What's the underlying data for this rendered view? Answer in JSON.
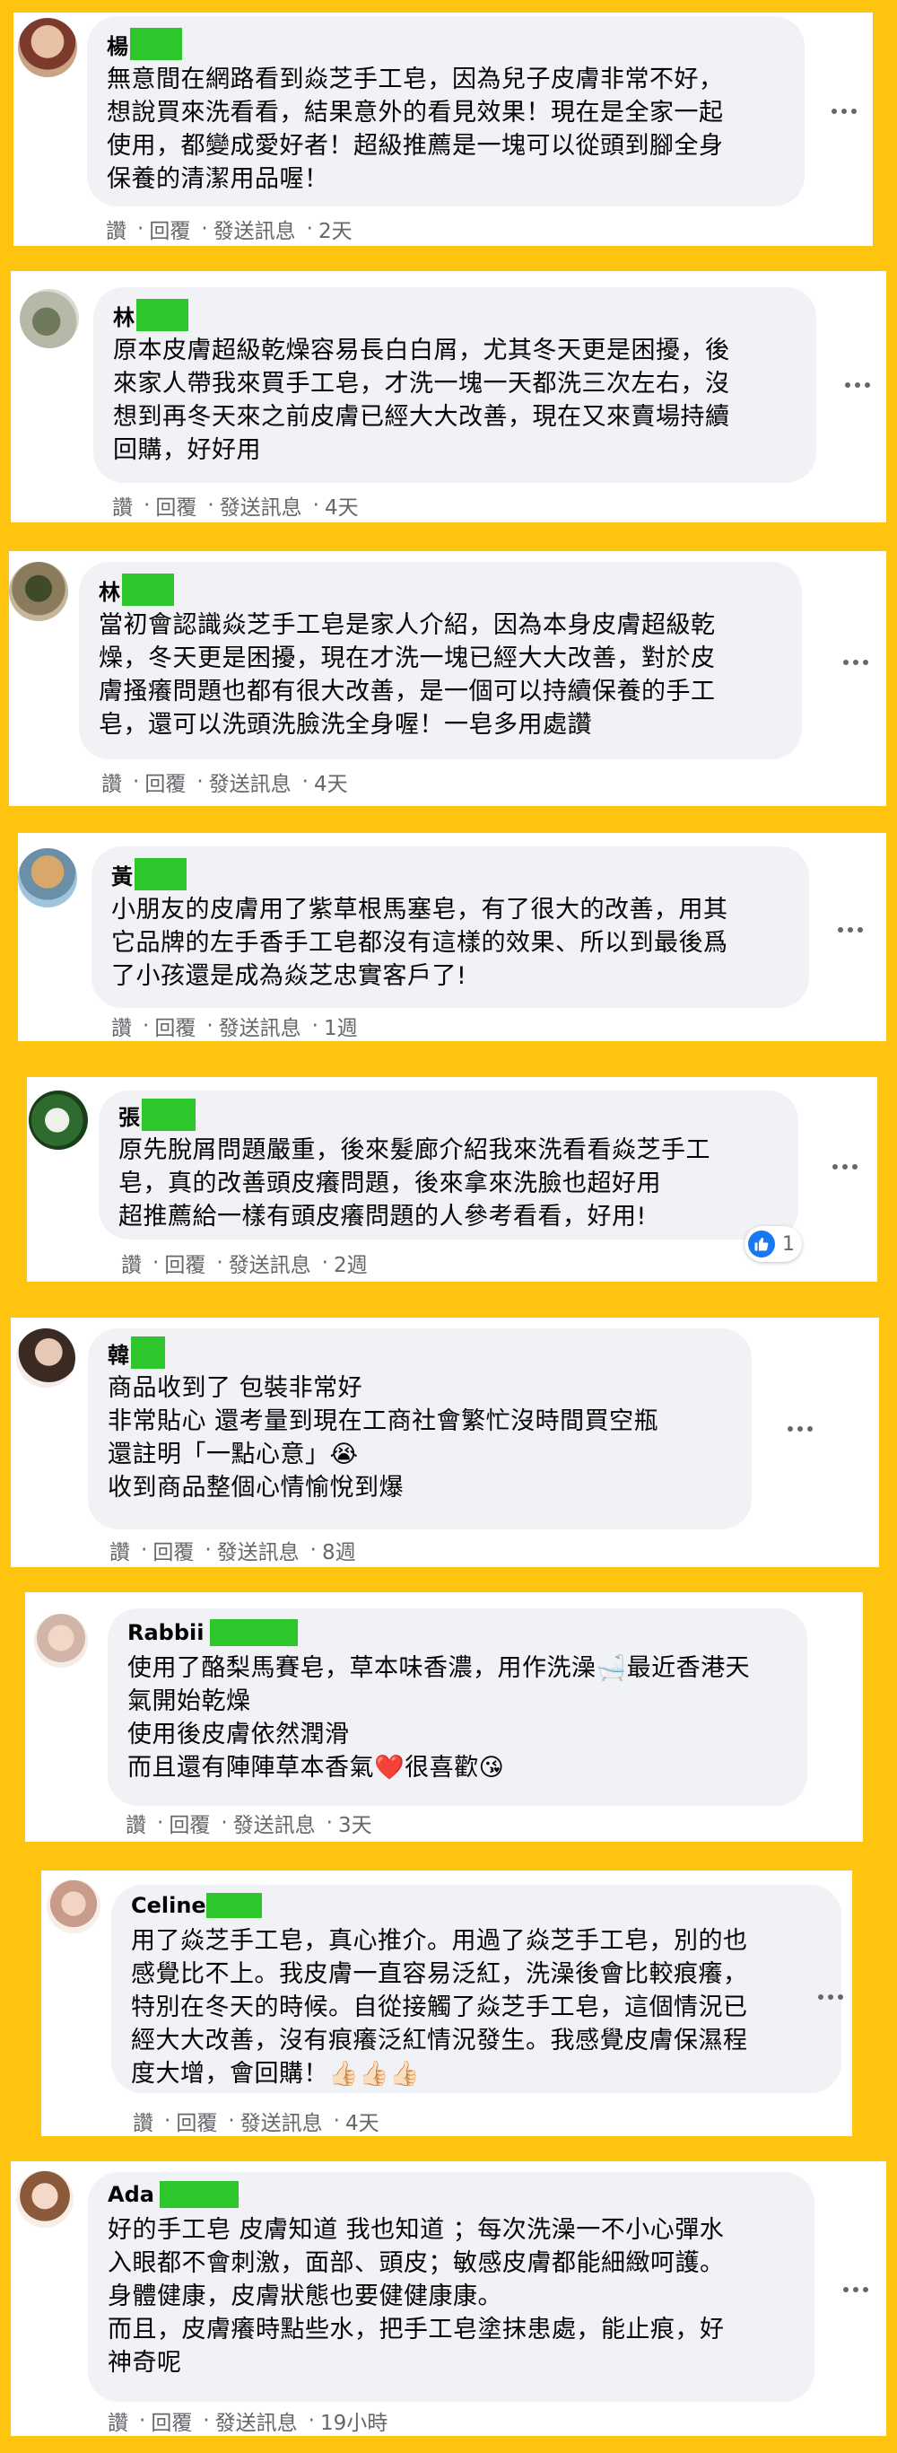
{
  "actions": {
    "like": "讚",
    "reply": "回覆",
    "message": "發送訊息",
    "sep": "·"
  },
  "comments": [
    {
      "name": "楊",
      "text": "無意間在網路看到焱芝手工皂，因為兒子皮膚非常不好，\n想說買來洗看看，結果意外的看見效果！現在是全家一起\n使用，都變成愛好者！超級推薦是一塊可以從頭到腳全身\n保養的清潔用品喔！",
      "time": "2天"
    },
    {
      "name": "林",
      "text": "原本皮膚超級乾燥容易長白白屑，尤其冬天更是困擾，後\n來家人帶我來買手工皂，才洗一塊一天都洗三次左右，沒\n想到再冬天來之前皮膚已經大大改善，現在又來賣場持續\n回購，好好用",
      "time": "4天"
    },
    {
      "name": "林",
      "text": "當初會認識焱芝手工皂是家人介紹，因為本身皮膚超級乾\n燥，冬天更是困擾，現在才洗一塊已經大大改善，對於皮\n膚搔癢問題也都有很大改善，是一個可以持續保養的手工\n皂，還可以洗頭洗臉洗全身喔！一皂多用處讚",
      "time": "4天"
    },
    {
      "name": "黃",
      "text": "小朋友的皮膚用了紫草根馬塞皂，有了很大的改善，用其\n它品牌的左手香手工皂都沒有這樣的效果、所以到最後爲\n了小孩還是成為焱芝忠實客戶了!",
      "time": "1週"
    },
    {
      "name": "張",
      "text": "原先脫屑問題嚴重，後來髮廊介紹我來洗看看焱芝手工\n皂，真的改善頭皮癢問題，後來拿來洗臉也超好用\n超推薦給一樣有頭皮癢問題的人參考看看，好用!",
      "time": "2週",
      "reactions": "1"
    },
    {
      "name": "韓",
      "text": "商品收到了 包裝非常好\n非常貼心 還考量到現在工商社會繁忙沒時間買空瓶\n還註明「一點心意」😭\n收到商品整個心情愉悅到爆",
      "time": "8週"
    },
    {
      "name": "Rabbii",
      "text": "使用了酪梨馬賽皂，草本味香濃，用作洗澡🛁最近香港天\n氣開始乾燥\n使用後皮膚依然潤滑\n而且還有陣陣草本香氣❤️很喜歡😘",
      "time": "3天"
    },
    {
      "name": "Celine",
      "text": "用了焱芝手工皂，真心推介。用過了焱芝手工皂，別的也\n感覺比不上。我皮膚一直容易泛紅，洗澡後會比較痕癢，\n特別在冬天的時候。自從接觸了焱芝手工皂，這個情況已\n經大大改善，沒有痕癢泛紅情況發生。我感覺皮膚保濕程\n度大增，會回購！👍🏻👍🏻👍🏻",
      "time": "4天"
    },
    {
      "name": "Ada",
      "text": "好的手工皂 皮膚知道 我也知道 ；每次洗澡一不小心彈水\n入眼都不會刺激，面部、頭皮；敏感皮膚都能細緻呵護。\n身體健康，皮膚狀態也要健健康康。\n而且，皮膚癢時點些水，把手工皂塗抹患處，能止痕，好\n神奇呢",
      "time": "19小時"
    }
  ],
  "colors": {
    "background": "#FFC410",
    "bubble": "#F0F2F5",
    "redaction": "#2DC72D",
    "meta": "#65676B"
  }
}
